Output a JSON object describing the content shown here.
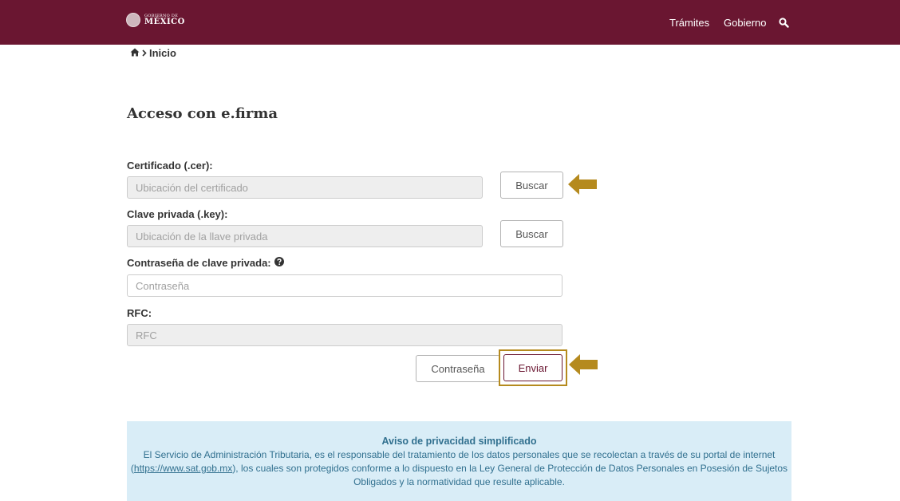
{
  "header": {
    "logo_small": "GOBIERNO DE",
    "logo_big": "MÉXICO",
    "nav_tramites": "Trámites",
    "nav_gobierno": "Gobierno"
  },
  "breadcrumb": {
    "label": "Inicio"
  },
  "page_title": "Acceso con e.firma",
  "form": {
    "cert_label": "Certificado (.cer):",
    "cert_placeholder": "Ubicación del certificado",
    "key_label": "Clave privada (.key):",
    "key_placeholder": "Ubicación de la llave privada",
    "buscar": "Buscar",
    "password_label": "Contraseña de clave privada:",
    "password_placeholder": "Contraseña",
    "rfc_label": "RFC:",
    "rfc_placeholder": "RFC",
    "contrasena_button": "Contraseña",
    "enviar_button": "Enviar"
  },
  "notice": {
    "title": "Aviso de privacidad simplificado",
    "text_before_link": "El Servicio de Administración Tributaria, es el responsable del tratamiento de los datos personales que se recolectan a través de su portal de internet (",
    "link": "https://www.sat.gob.mx",
    "text_after_link": "), los cuales son protegidos conforme a lo dispuesto en la Ley General de Protección de Datos Personales en Posesión de Sujetos Obligados y la normatividad que resulte aplicable."
  },
  "colors": {
    "brand": "#6a1631",
    "arrow": "#b58a1e",
    "notice_bg": "#d9edf7",
    "notice_text": "#31708f"
  },
  "icons": [
    "seal-icon",
    "search-icon",
    "home-icon",
    "chevron-right-icon",
    "question-circle-icon",
    "arrow-left-icon"
  ]
}
